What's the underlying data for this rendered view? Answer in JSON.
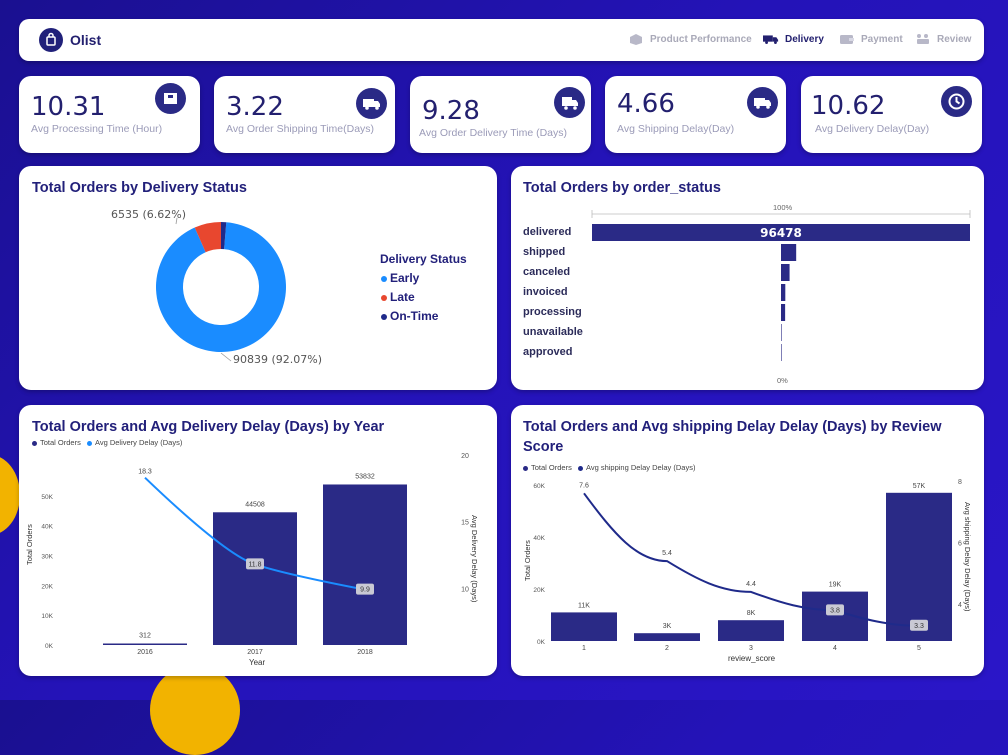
{
  "header": {
    "brand": "Olist",
    "nav": [
      {
        "label": "Product Performance",
        "icon": "box-icon",
        "active": false
      },
      {
        "label": "Delivery",
        "icon": "truck-icon",
        "active": true
      },
      {
        "label": "Payment",
        "icon": "wallet-icon",
        "active": false
      },
      {
        "label": "Review",
        "icon": "review-icon",
        "active": false
      }
    ]
  },
  "kpis": [
    {
      "value": "10.31",
      "label": "Avg Processing Time (Hour)",
      "icon": "package-icon"
    },
    {
      "value": "3.22",
      "label": "Avg Order Shipping Time(Days)",
      "icon": "truck-icon"
    },
    {
      "value": "9.28",
      "label": "Avg Order Delivery Time (Days)",
      "icon": "delivery-icon"
    },
    {
      "value": "4.66",
      "label": "Avg Shipping Delay(Day)",
      "icon": "truck-icon"
    },
    {
      "value": "10.62",
      "label": "Avg Delivery Delay(Day)",
      "icon": "clock-icon"
    }
  ],
  "donut": {
    "title": "Total Orders by Delivery Status",
    "legend_title": "Delivery Status",
    "label_early": "90839 (92.07%)",
    "label_late": "6535 (6.62%)",
    "colors": {
      "Early": "#1a8cff",
      "Late": "#e8472f",
      "On-Time": "#1f2a8a"
    }
  },
  "status": {
    "title": "Total Orders by order_status",
    "top_label": "100%",
    "bottom_label": "0%",
    "value_label": "96478"
  },
  "year_chart": {
    "title": "Total Orders and Avg Delivery Delay (Days) by Year",
    "legend": [
      "Total Orders",
      "Avg Delivery Delay (Days)"
    ],
    "xlabel": "Year",
    "ylabel_left": "Total Orders",
    "ylabel_right": "Avg Delivery Delay (Days)",
    "left_ticks": [
      "50K",
      "40K",
      "30K",
      "20K",
      "10K",
      "0K"
    ],
    "right_ticks": [
      "20",
      "15",
      "10"
    ]
  },
  "review_chart": {
    "title": "Total Orders and Avg shipping Delay Delay (Days) by Review Score",
    "legend": [
      "Total Orders",
      "Avg shipping Delay Delay (Days)"
    ],
    "xlabel": "review_score",
    "ylabel_left": "Total Orders",
    "ylabel_right": "Avg shipping Delay Delay (Days)",
    "left_ticks": [
      "60K",
      "40K",
      "20K",
      "0K"
    ],
    "right_ticks": [
      "8",
      "6",
      "4"
    ]
  },
  "chart_data": [
    {
      "type": "pie",
      "title": "Total Orders by Delivery Status",
      "categories": [
        "Early",
        "Late",
        "On-Time"
      ],
      "values": [
        90839,
        6535,
        1280
      ],
      "labels": [
        "90839 (92.07%)",
        "6535 (6.62%)",
        ""
      ]
    },
    {
      "type": "bar",
      "title": "Total Orders by order_status",
      "categories": [
        "delivered",
        "shipped",
        "canceled",
        "invoiced",
        "processing",
        "unavailable",
        "approved"
      ],
      "values": [
        96478,
        1107,
        625,
        314,
        301,
        6,
        2
      ],
      "data_labels": [
        "96478",
        "",
        "",
        "",
        "",
        "",
        ""
      ]
    },
    {
      "type": "bar",
      "title": "Total Orders and Avg Delivery Delay (Days) by Year",
      "categories": [
        "2016",
        "2017",
        "2018"
      ],
      "series": [
        {
          "name": "Total Orders",
          "values": [
            312,
            44508,
            53832
          ],
          "labels": [
            "312",
            "44508",
            "53832"
          ]
        },
        {
          "name": "Avg Delivery Delay (Days)",
          "values": [
            18.3,
            11.8,
            9.9
          ],
          "labels": [
            "18.3",
            "11.8",
            "9.9"
          ]
        }
      ],
      "ylim": [
        0,
        55000
      ],
      "ylim_right": [
        8,
        20
      ]
    },
    {
      "type": "bar",
      "title": "Total Orders and Avg shipping Delay Delay (Days) by Review Score",
      "categories": [
        "1",
        "2",
        "3",
        "4",
        "5"
      ],
      "series": [
        {
          "name": "Total Orders",
          "values": [
            11000,
            3000,
            8000,
            19000,
            57000
          ],
          "labels": [
            "11K",
            "3K",
            "8K",
            "19K",
            "57K"
          ]
        },
        {
          "name": "Avg shipping Delay Delay (Days)",
          "values": [
            7.6,
            5.4,
            4.4,
            3.8,
            3.3
          ],
          "labels": [
            "7.6",
            "5.4",
            "4.4",
            "3.8",
            "3.3"
          ]
        }
      ],
      "ylim": [
        0,
        60000
      ],
      "ylim_right": [
        3,
        8
      ]
    }
  ]
}
